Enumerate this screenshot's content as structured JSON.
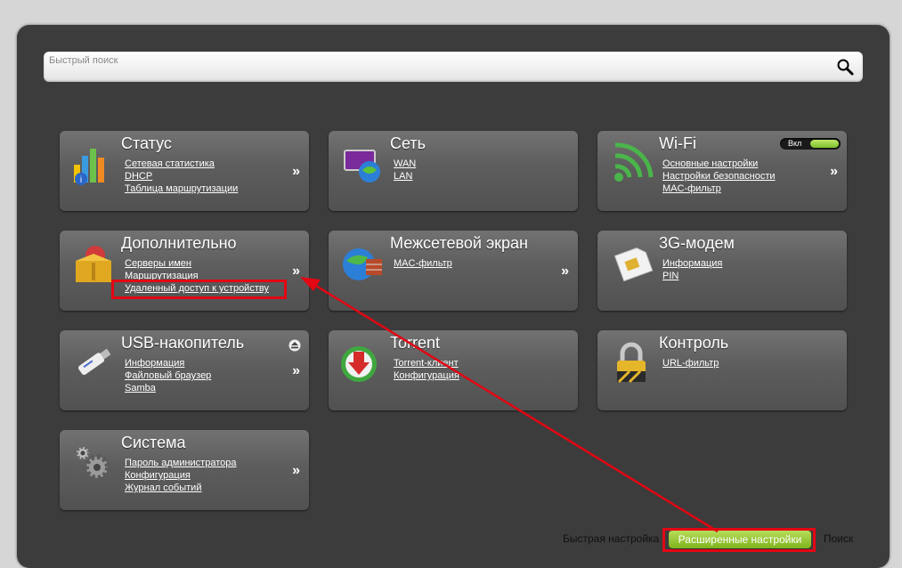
{
  "search": {
    "placeholder": "Быстрый поиск",
    "value": ""
  },
  "tiles": {
    "status": {
      "title": "Статус",
      "links": [
        "Сетевая статистика",
        "DHCP",
        "Таблица маршрутизации"
      ],
      "chevron": "»"
    },
    "network": {
      "title": "Сеть",
      "links": [
        "WAN",
        "LAN"
      ]
    },
    "wifi": {
      "title": "Wi-Fi",
      "toggle_label": "Вкл",
      "links": [
        "Основные настройки",
        "Настройки безопасности",
        "MAC-фильтр"
      ],
      "chevron": "»"
    },
    "advanced": {
      "title": "Дополнительно",
      "links": [
        "Серверы имен",
        "Маршрутизация",
        "Удаленный доступ к устройству"
      ],
      "chevron": "»"
    },
    "firewall": {
      "title": "Межсетевой экран",
      "links": [
        "MAC-фильтр"
      ],
      "chevron": "»"
    },
    "modem3g": {
      "title": "3G-модем",
      "links": [
        "Информация",
        "PIN"
      ]
    },
    "usb": {
      "title": "USB-накопитель",
      "links": [
        "Информация",
        "Файловый браузер",
        "Samba"
      ],
      "chevron": "»"
    },
    "torrent": {
      "title": "Torrent",
      "links": [
        "Torrent-клиент",
        "Конфигурация"
      ]
    },
    "control": {
      "title": "Контроль",
      "links": [
        "URL-фильтр"
      ]
    },
    "system": {
      "title": "Система",
      "links": [
        "Пароль администратора",
        "Конфигурация",
        "Журнал событий"
      ],
      "chevron": "»"
    }
  },
  "bottom_bar": {
    "quick_setup": "Быстрая настройка",
    "advanced_settings": "Расширенные настройки",
    "search": "Поиск"
  },
  "colors": {
    "annotation": "#e30613",
    "accent_green": "#8cc63f",
    "panel": "#3c3c3c"
  }
}
